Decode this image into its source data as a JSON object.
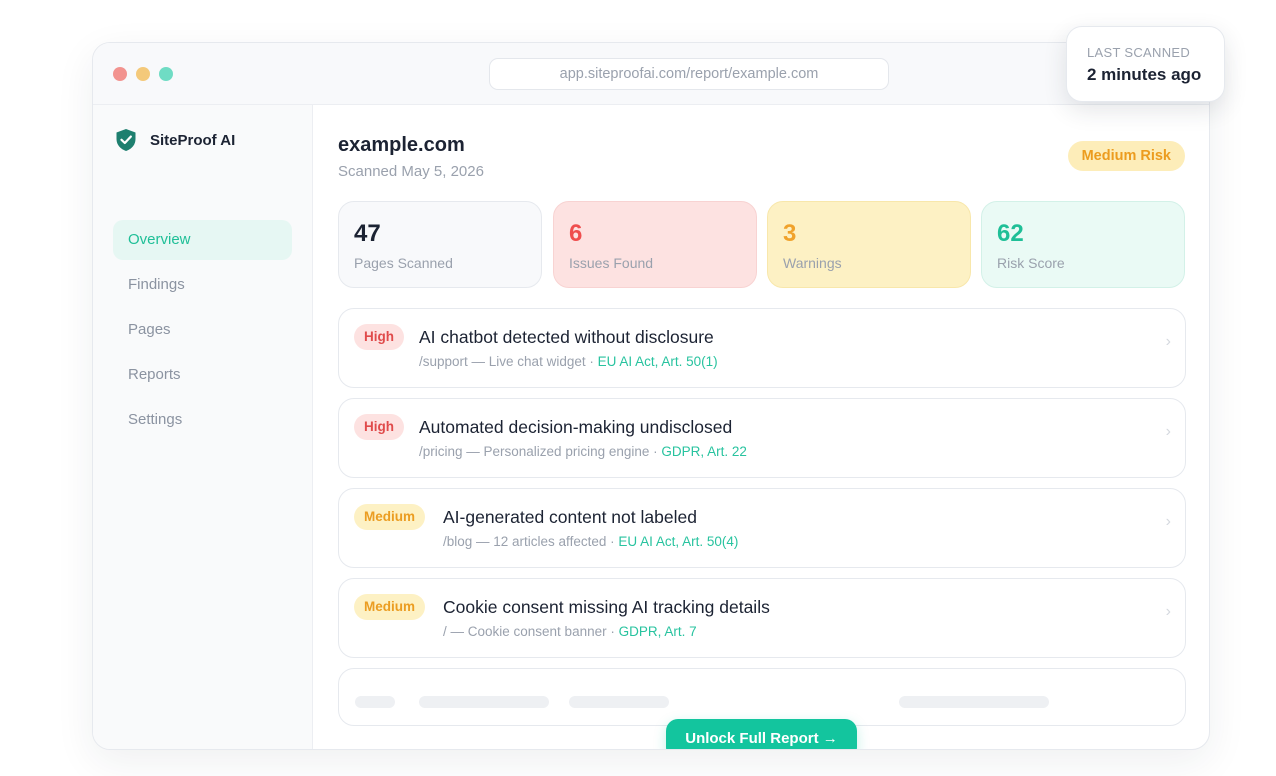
{
  "browser": {
    "url": "app.siteproofai.com/report/example.com"
  },
  "brand": {
    "name": "SiteProof AI",
    "icon": "shield-check-icon",
    "color": "#1e7f6f"
  },
  "sidebar": {
    "items": [
      {
        "label": "Overview",
        "active": true
      },
      {
        "label": "Findings",
        "active": false
      },
      {
        "label": "Pages",
        "active": false
      },
      {
        "label": "Reports",
        "active": false
      },
      {
        "label": "Settings",
        "active": false
      }
    ]
  },
  "header": {
    "site": "example.com",
    "scanned": "Scanned May 5, 2026",
    "risk_badge": "Medium Risk"
  },
  "stats": [
    {
      "value": "47",
      "label": "Pages Scanned"
    },
    {
      "value": "6",
      "label": "Issues Found"
    },
    {
      "value": "3",
      "label": "Warnings"
    },
    {
      "value": "62",
      "label": "Risk Score"
    }
  ],
  "findings": [
    {
      "severity": "High",
      "title": "AI chatbot detected without disclosure",
      "meta": "/support — Live chat widget · ",
      "ref": "EU AI Act, Art. 50(1)"
    },
    {
      "severity": "High",
      "title": "Automated decision-making undisclosed",
      "meta": "/pricing — Personalized pricing engine · ",
      "ref": "GDPR, Art. 22"
    },
    {
      "severity": "Medium",
      "title": "AI-generated content not labeled",
      "meta": "/blog — 12 articles affected · ",
      "ref": "EU AI Act, Art. 50(4)"
    },
    {
      "severity": "Medium",
      "title": "Cookie consent missing AI tracking details",
      "meta": "/ — Cookie consent banner · ",
      "ref": "GDPR, Art. 7"
    }
  ],
  "unlock": {
    "label": "Unlock Full Report →"
  },
  "last_scanned": {
    "label": "LAST SCANNED",
    "value": "2 minutes ago"
  },
  "colors": {
    "accent": "#13c59e",
    "high": "#e04b4b",
    "medium": "#eb9d22",
    "text": "#1c2333",
    "muted": "#9aa1ad"
  }
}
